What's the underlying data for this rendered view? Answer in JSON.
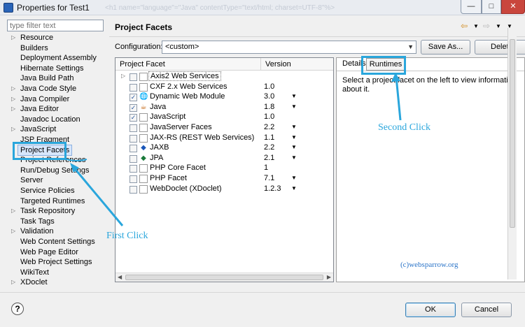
{
  "window": {
    "title": "Properties for Test1",
    "buttons": {
      "minimize": "—",
      "maximize": "□",
      "close": "✕"
    },
    "ghost_text": "<h1 name=\"language\"=\"Java\" contentType=\"text/html; charset=UTF-8\"%>"
  },
  "filter": {
    "placeholder": "type filter text"
  },
  "nav": {
    "items": [
      {
        "label": "Resource",
        "expandable": true
      },
      {
        "label": "Builders",
        "expandable": false
      },
      {
        "label": "Deployment Assembly",
        "expandable": false
      },
      {
        "label": "Hibernate Settings",
        "expandable": false
      },
      {
        "label": "Java Build Path",
        "expandable": false
      },
      {
        "label": "Java Code Style",
        "expandable": true
      },
      {
        "label": "Java Compiler",
        "expandable": true
      },
      {
        "label": "Java Editor",
        "expandable": true
      },
      {
        "label": "Javadoc Location",
        "expandable": false
      },
      {
        "label": "JavaScript",
        "expandable": true
      },
      {
        "label": "JSP Fragment",
        "expandable": false
      },
      {
        "label": "Project Facets",
        "expandable": false,
        "selected": true
      },
      {
        "label": "Project References",
        "expandable": false
      },
      {
        "label": "Run/Debug Settings",
        "expandable": false
      },
      {
        "label": "Server",
        "expandable": false
      },
      {
        "label": "Service Policies",
        "expandable": false
      },
      {
        "label": "Targeted Runtimes",
        "expandable": false
      },
      {
        "label": "Task Repository",
        "expandable": true
      },
      {
        "label": "Task Tags",
        "expandable": false
      },
      {
        "label": "Validation",
        "expandable": true
      },
      {
        "label": "Web Content Settings",
        "expandable": false
      },
      {
        "label": "Web Page Editor",
        "expandable": false
      },
      {
        "label": "Web Project Settings",
        "expandable": false
      },
      {
        "label": "WikiText",
        "expandable": false
      },
      {
        "label": "XDoclet",
        "expandable": true
      }
    ]
  },
  "page": {
    "title": "Project Facets"
  },
  "configuration": {
    "label": "Configuration:",
    "value": "<custom>",
    "save_as": "Save As...",
    "delete": "Delete"
  },
  "facets": {
    "col_facet": "Project Facet",
    "col_version": "Version",
    "rows": [
      {
        "name": "Axis2 Web Services",
        "version": "",
        "checked": false,
        "expandable": true,
        "icon": "doc-icon",
        "dropdown": false
      },
      {
        "name": "CXF 2.x Web Services",
        "version": "1.0",
        "checked": false,
        "expandable": false,
        "icon": "doc-icon",
        "dropdown": false
      },
      {
        "name": "Dynamic Web Module",
        "version": "3.0",
        "checked": true,
        "expandable": false,
        "icon": "web-module-icon",
        "dropdown": true
      },
      {
        "name": "Java",
        "version": "1.8",
        "checked": true,
        "expandable": false,
        "icon": "java-icon",
        "dropdown": true
      },
      {
        "name": "JavaScript",
        "version": "1.0",
        "checked": true,
        "expandable": false,
        "icon": "doc-icon",
        "dropdown": false
      },
      {
        "name": "JavaServer Faces",
        "version": "2.2",
        "checked": false,
        "expandable": false,
        "icon": "doc-icon",
        "dropdown": true
      },
      {
        "name": "JAX-RS (REST Web Services)",
        "version": "1.1",
        "checked": false,
        "expandable": false,
        "icon": "doc-icon",
        "dropdown": true
      },
      {
        "name": "JAXB",
        "version": "2.2",
        "checked": false,
        "expandable": false,
        "icon": "jaxb-icon",
        "dropdown": true
      },
      {
        "name": "JPA",
        "version": "2.1",
        "checked": false,
        "expandable": false,
        "icon": "jpa-icon",
        "dropdown": true
      },
      {
        "name": "PHP Core Facet",
        "version": "1",
        "checked": false,
        "expandable": false,
        "icon": "doc-icon",
        "dropdown": false
      },
      {
        "name": "PHP Facet",
        "version": "7.1",
        "checked": false,
        "expandable": false,
        "icon": "doc-icon",
        "dropdown": true
      },
      {
        "name": "WebDoclet (XDoclet)",
        "version": "1.2.3",
        "checked": false,
        "expandable": false,
        "icon": "doc-icon",
        "dropdown": true
      }
    ]
  },
  "details": {
    "tab_details": "Details",
    "tab_runtimes": "Runtimes",
    "text": "Select a project facet on the left to view information about it."
  },
  "footer": {
    "help": "?",
    "ok": "OK",
    "cancel": "Cancel"
  },
  "annotations": {
    "first_click": "First Click",
    "second_click": "Second Click",
    "watermark": "(c)websparrow.org",
    "color": "#2aa6dc"
  }
}
